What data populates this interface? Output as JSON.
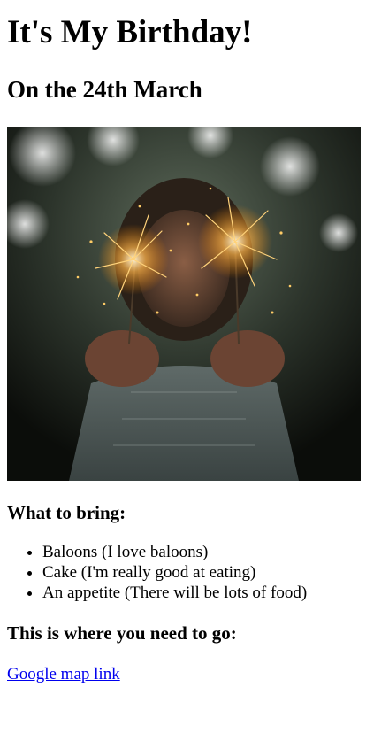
{
  "page": {
    "title": "It's My Birthday!",
    "date": "On the 24th March"
  },
  "bring": {
    "heading": "What to bring:",
    "items": [
      "Baloons (I love baloons)",
      "Cake (I'm really good at eating)",
      "An appetite (There will be lots of food)"
    ]
  },
  "location": {
    "heading": "This is where you need to go:",
    "link_text": "Google map link"
  },
  "hero_image": {
    "subject": "woman holding two lit sparklers"
  }
}
